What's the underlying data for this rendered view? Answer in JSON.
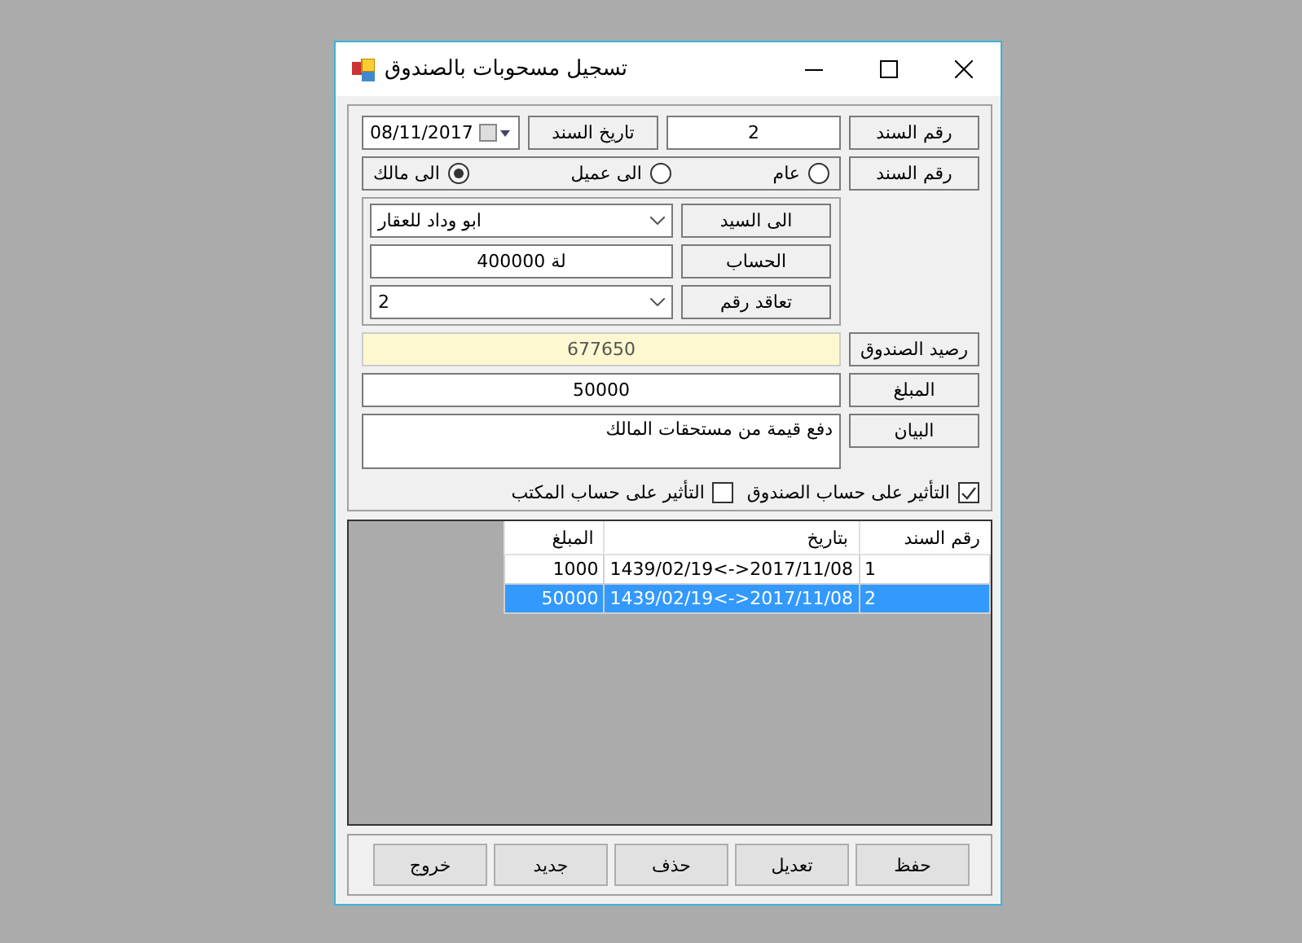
{
  "window": {
    "title": "تسجيل مسحوبات بالصندوق"
  },
  "voucher_number": {
    "label": "رقم السند",
    "value": "2"
  },
  "voucher_date": {
    "label": "تاريخ السند",
    "value": "08/11/2017"
  },
  "recipient_type": {
    "label": "رقم السند",
    "options": [
      {
        "label": "عام",
        "selected": false
      },
      {
        "label": "الى عميل",
        "selected": false
      },
      {
        "label": "الى مالك",
        "selected": true
      }
    ]
  },
  "party": [
    {
      "kind": "combo",
      "label": "الى السيد",
      "value": "ابو وداد للعقار"
    },
    {
      "kind": "text",
      "label": "الحساب",
      "value": "لة 400000"
    },
    {
      "kind": "combo",
      "label": "تعاقد رقم",
      "value": "2"
    }
  ],
  "balance": {
    "label": "رصيد الصندوق",
    "value": "677650"
  },
  "amount": {
    "label": "المبلغ",
    "value": "50000"
  },
  "statement": {
    "label": "البيان",
    "value": "دفع قيمة من مستحقات المالك"
  },
  "checkboxes": [
    {
      "label": "التأثير على حساب الصندوق",
      "checked": true
    },
    {
      "label": "التأثير على حساب المكتب",
      "checked": false
    }
  ],
  "table": {
    "columns": [
      "رقم السند",
      "بتاريخ",
      "المبلغ"
    ],
    "rows": [
      {
        "cells": [
          "1",
          "1439/02/19<->2017/11/08",
          "1000"
        ],
        "selected": false
      },
      {
        "cells": [
          "2",
          "1439/02/19<->2017/11/08",
          "50000"
        ],
        "selected": true
      }
    ]
  },
  "buttons": [
    "حفظ",
    "تعديل",
    "حذف",
    "جديد",
    "خروج"
  ]
}
